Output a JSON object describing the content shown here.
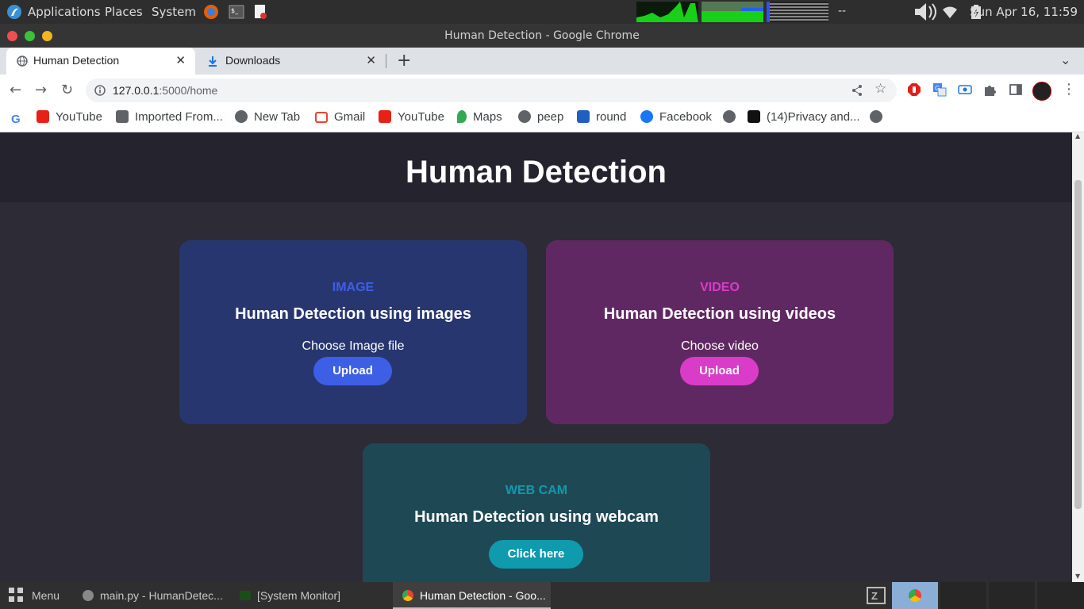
{
  "panel": {
    "menus": [
      "Applications",
      "Places",
      "System"
    ],
    "graph_text": "--",
    "clock": "Sun Apr 16, 11:59"
  },
  "window": {
    "title": "Human Detection - Google Chrome"
  },
  "tabs": [
    {
      "label": "Human Detection",
      "icon": "globe-icon",
      "active": true
    },
    {
      "label": "Downloads",
      "icon": "download-icon",
      "active": false
    }
  ],
  "toolbar": {
    "url_host": "127.0.0.1",
    "url_rest": ":5000/home"
  },
  "bookmarks": [
    {
      "label": "",
      "icon": "google-icon"
    },
    {
      "label": "YouTube",
      "icon": "youtube-icon"
    },
    {
      "label": "Imported From...",
      "icon": "folder-icon"
    },
    {
      "label": "New Tab",
      "icon": "globe-icon"
    },
    {
      "label": "Gmail",
      "icon": "gmail-icon"
    },
    {
      "label": "YouTube",
      "icon": "youtube-icon"
    },
    {
      "label": "Maps",
      "icon": "maps-icon"
    },
    {
      "label": "peep",
      "icon": "globe-icon"
    },
    {
      "label": "round",
      "icon": "round-icon"
    },
    {
      "label": "Facebook",
      "icon": "facebook-icon"
    },
    {
      "label": "",
      "icon": "globe-icon"
    },
    {
      "label": "(14)Privacy and...",
      "icon": "tiktok-icon"
    },
    {
      "label": "",
      "icon": "globe-icon"
    }
  ],
  "page": {
    "title": "Human Detection",
    "cards": [
      {
        "kind": "IMAGE",
        "title": "Human Detection using images",
        "choose": "Choose Image file",
        "button": "Upload",
        "bg": "#283670",
        "accent": "#3d5fe6"
      },
      {
        "kind": "VIDEO",
        "title": "Human Detection using videos",
        "choose": "Choose video",
        "button": "Upload",
        "bg": "#602862",
        "accent": "#d93cc8"
      },
      {
        "kind": "WEB CAM",
        "title": "Human Detection using webcam",
        "choose": "",
        "button": "Click here",
        "bg": "#1f4855",
        "accent": "#0f9aae"
      }
    ]
  },
  "taskbar": {
    "menu": "Menu",
    "tasks": [
      {
        "label": "main.py - HumanDetec...",
        "active": false
      },
      {
        "label": "[System Monitor]",
        "active": false
      },
      {
        "label": "Human Detection - Goo...",
        "active": true
      }
    ]
  }
}
